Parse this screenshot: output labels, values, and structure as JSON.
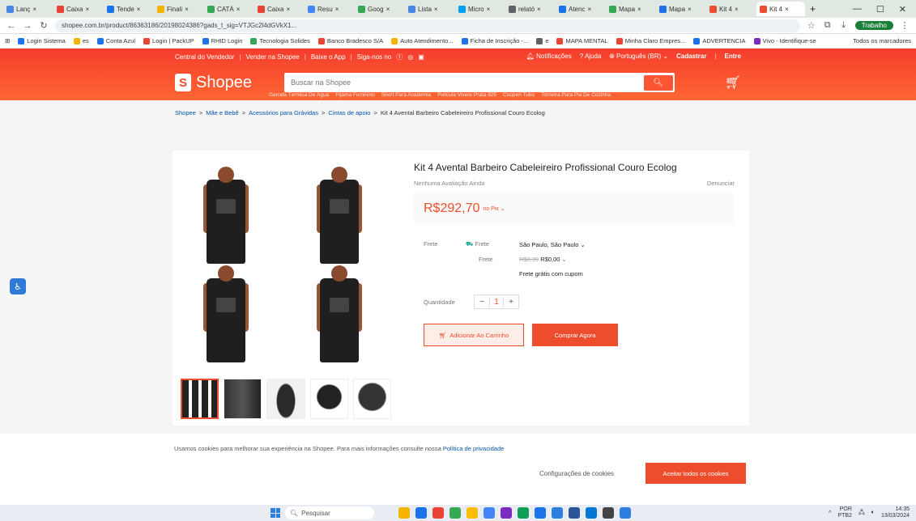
{
  "browser": {
    "tabs": [
      {
        "label": "Lanç",
        "color": "#4a86e8"
      },
      {
        "label": "Caixa",
        "color": "#ea4335"
      },
      {
        "label": "Tende",
        "color": "#1a73e8"
      },
      {
        "label": "Finali",
        "color": "#f4b400"
      },
      {
        "label": "CATÁ",
        "color": "#34a853"
      },
      {
        "label": "Caixa",
        "color": "#ea4335"
      },
      {
        "label": "Resu",
        "color": "#4285f4"
      },
      {
        "label": "Goog",
        "color": "#34a853"
      },
      {
        "label": "Lista",
        "color": "#4a86e8"
      },
      {
        "label": "Micro",
        "color": "#00a1f1"
      },
      {
        "label": "relató",
        "color": "#5f6368"
      },
      {
        "label": "Atenc",
        "color": "#1a73e8"
      },
      {
        "label": "Mapa",
        "color": "#34a853"
      },
      {
        "label": "Mapa",
        "color": "#1a73e8"
      },
      {
        "label": "Kit 4",
        "color": "#ee4d2d"
      },
      {
        "label": "Kit 4",
        "color": "#ee4d2d",
        "active": true
      }
    ],
    "url": "shopee.com.br/product/86363186/20198024386?gads_t_sig=VTJGc2l4dGVkX1...",
    "profile_label": "Trabalho",
    "bookmarks": [
      {
        "label": "Login Sistema",
        "color": "#1a73e8"
      },
      {
        "label": "es",
        "color": "#f4b400"
      },
      {
        "label": "Conta Azul",
        "color": "#1a73e8"
      },
      {
        "label": "Login | PackUP",
        "color": "#ea4335"
      },
      {
        "label": "RHID Login",
        "color": "#1a73e8"
      },
      {
        "label": "Tecnologia Solides",
        "color": "#34a853"
      },
      {
        "label": "Banco Bradesco S/A",
        "color": "#ea4335"
      },
      {
        "label": "Auto Atendimento...",
        "color": "#f4b400"
      },
      {
        "label": "Ficha de Inscrição -...",
        "color": "#1a73e8"
      },
      {
        "label": "e",
        "color": "#5f6368"
      },
      {
        "label": "MAPA MENTAL",
        "color": "#ea4335"
      },
      {
        "label": "Minha Claro Empres...",
        "color": "#ea4335"
      },
      {
        "label": "ADVERTENCIA",
        "color": "#1a73e8"
      },
      {
        "label": "Vivo - Identifique-se",
        "color": "#7b2cbf"
      }
    ],
    "bookmarks_more": "Todos os marcadores"
  },
  "topnav": {
    "left": [
      "Central do Vendedor",
      "Vender na Shopee",
      "Baixe o App",
      "Siga-nos no"
    ],
    "notifications": "Notificações",
    "help": "Ajuda",
    "language": "Português (BR)",
    "register": "Cadastrar",
    "login": "Entre"
  },
  "header": {
    "logo_text": "Shopee",
    "search_placeholder": "Buscar na Shopee",
    "suggestions": [
      "Garrafa Térmica De Água",
      "Pijama Feminino",
      "Short Para Academia",
      "Pelicula Vivere Prata 925",
      "Cooperl Tubo",
      "Torneira Para Pia De Cozinha"
    ]
  },
  "breadcrumb": [
    "Shopee",
    "Mãe e Bebê",
    "Acessórios para Grávidas",
    "Cintas de apoio",
    "Kit 4 Avental Barbeiro Cabeleireiro Profissional Couro Ecolog"
  ],
  "product": {
    "title": "Kit 4 Avental Barbeiro Cabeleireiro Profissional Couro Ecolog",
    "rating": "Nenhuma Avaliação Ainda",
    "report": "Denunciar",
    "price": "R$292,70",
    "price_tag": "no Pix",
    "frete_label": "Frete",
    "frete_to_label": "Frete",
    "frete_location": "São Paulo, São Paulo",
    "frete_cost_label": "Frete",
    "frete_old": "R$8,99",
    "frete_new": "R$0,00",
    "frete_free": "Frete grátis com cupom",
    "qty_label": "Quantidade",
    "qty_value": "1",
    "add_to_cart": "Adicionar Ao Carrinho",
    "buy_now": "Comprar Agora"
  },
  "cookie": {
    "text": "Usamos cookies para melhorar sua experiência na Shopee. Para mais informações consulte nossa",
    "link": "Política de privacidade",
    "config": "Configurações de cookies",
    "accept": "Aceitar todos os cookies"
  },
  "taskbar": {
    "search": "Pesquisar",
    "apps": [
      "#f4b400",
      "#1a73e8",
      "#ea4335",
      "#34a853",
      "#fbbc05",
      "#4285f4",
      "#7b2cbf",
      "#0f9d58",
      "#1a73e8",
      "#2d7ee0",
      "#2a5699",
      "#0078d4",
      "#444444",
      "#2d7ee0"
    ],
    "lang": "POR",
    "lang2": "PTB2",
    "time": "14:35",
    "date": "13/03/2024"
  }
}
